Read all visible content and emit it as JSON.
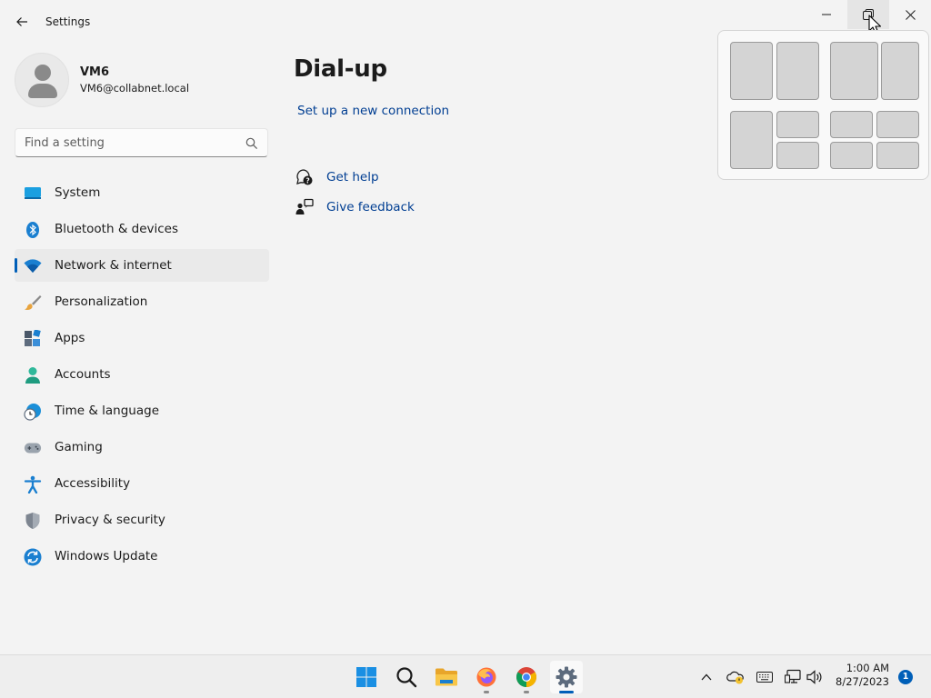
{
  "window": {
    "title": "Settings",
    "controls": [
      "minimize",
      "maximize",
      "close"
    ]
  },
  "profile": {
    "name": "VM6",
    "email": "VM6@collabnet.local"
  },
  "search": {
    "placeholder": "Find a setting",
    "value": ""
  },
  "sidebar": {
    "items": [
      {
        "label": "System",
        "icon": "system-icon",
        "selected": false
      },
      {
        "label": "Bluetooth & devices",
        "icon": "bluetooth-icon",
        "selected": false
      },
      {
        "label": "Network & internet",
        "icon": "wifi-icon",
        "selected": true
      },
      {
        "label": "Personalization",
        "icon": "brush-icon",
        "selected": false
      },
      {
        "label": "Apps",
        "icon": "apps-icon",
        "selected": false
      },
      {
        "label": "Accounts",
        "icon": "accounts-icon",
        "selected": false
      },
      {
        "label": "Time & language",
        "icon": "clock-globe-icon",
        "selected": false
      },
      {
        "label": "Gaming",
        "icon": "gamepad-icon",
        "selected": false
      },
      {
        "label": "Accessibility",
        "icon": "accessibility-icon",
        "selected": false
      },
      {
        "label": "Privacy & security",
        "icon": "shield-icon",
        "selected": false
      },
      {
        "label": "Windows Update",
        "icon": "update-icon",
        "selected": false
      }
    ]
  },
  "main": {
    "title": "Dial-up",
    "new_connection_link": "Set up a new connection",
    "help_links": [
      {
        "label": "Get help",
        "icon": "help-icon"
      },
      {
        "label": "Give feedback",
        "icon": "feedback-icon"
      }
    ]
  },
  "snap_layouts": {
    "layouts": [
      "two-column",
      "wide-narrow",
      "one-left-two-right",
      "quadrants"
    ]
  },
  "taskbar": {
    "apps": [
      "start",
      "search",
      "file-explorer",
      "firefox",
      "chrome",
      "settings"
    ],
    "active_app": "settings",
    "clock_time": "1:00 AM",
    "clock_date": "8/27/2023",
    "notification_count": "1"
  },
  "colors": {
    "accent": "#005fb8",
    "link": "#003e92",
    "background": "#f3f3f3"
  }
}
